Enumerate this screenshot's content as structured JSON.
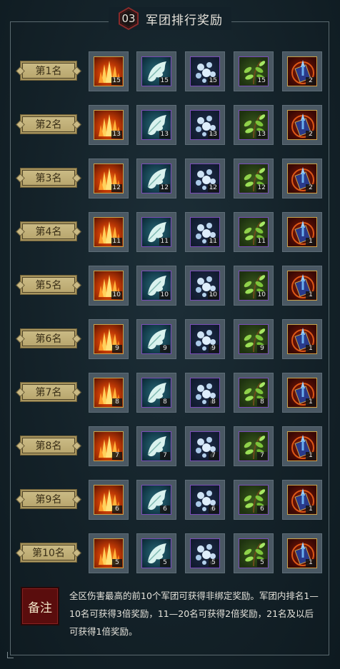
{
  "header": {
    "number": "03",
    "title": "军团排行奖励"
  },
  "rows": [
    {
      "rank": "第1名",
      "counts": [
        "15",
        "15",
        "15",
        "15",
        "2"
      ]
    },
    {
      "rank": "第2名",
      "counts": [
        "13",
        "13",
        "13",
        "13",
        "2"
      ]
    },
    {
      "rank": "第3名",
      "counts": [
        "12",
        "12",
        "12",
        "12",
        "2"
      ]
    },
    {
      "rank": "第4名",
      "counts": [
        "11",
        "11",
        "11",
        "11",
        "1"
      ]
    },
    {
      "rank": "第5名",
      "counts": [
        "10",
        "10",
        "10",
        "10",
        "1"
      ]
    },
    {
      "rank": "第6名",
      "counts": [
        "9",
        "9",
        "9",
        "9",
        "1"
      ]
    },
    {
      "rank": "第7名",
      "counts": [
        "8",
        "8",
        "8",
        "8",
        "1"
      ]
    },
    {
      "rank": "第8名",
      "counts": [
        "7",
        "7",
        "7",
        "7",
        "1"
      ]
    },
    {
      "rank": "第9名",
      "counts": [
        "6",
        "6",
        "6",
        "6",
        "1"
      ]
    },
    {
      "rank": "第10名",
      "counts": [
        "5",
        "5",
        "5",
        "5",
        "1"
      ]
    }
  ],
  "item_icons": [
    "crystal-icon",
    "feather-icon",
    "pearl-icon",
    "leaf-icon",
    "scroll-icon"
  ],
  "note": {
    "label": "备注",
    "text": "全区伤害最高的前10个军团可获得非绑定奖励。军团内排名1—10名可获得3倍奖励，11—20名可获得2倍奖励，21名及以后可获得1倍奖励。"
  },
  "colors": {
    "background": "#142229",
    "rank_badge": "#c9b984",
    "note_badge": "#5a0d0d"
  }
}
